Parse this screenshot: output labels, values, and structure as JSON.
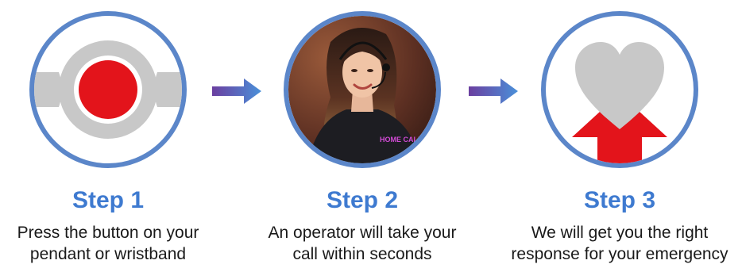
{
  "colors": {
    "ring": "#5b86c9",
    "title": "#3e7ad0",
    "red": "#e3141b",
    "gray": "#c8c8c8",
    "arrow_start": "#6b3fa0",
    "arrow_end": "#4a90d9"
  },
  "steps": [
    {
      "title": "Step 1",
      "line1": "Press the button on your",
      "line2": "pendant or wristband",
      "icon": "alarm-button-icon"
    },
    {
      "title": "Step 2",
      "line1": "An operator will take your",
      "line2": "call within seconds",
      "icon": "operator-photo"
    },
    {
      "title": "Step 3",
      "line1": "We will get you the right",
      "line2": "response for your emergency",
      "icon": "heart-arrow-icon"
    }
  ],
  "photo_logo": "HOME CALL"
}
